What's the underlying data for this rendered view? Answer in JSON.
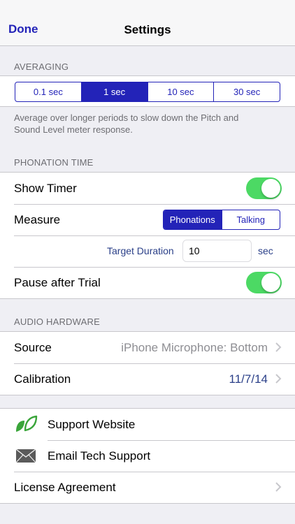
{
  "nav": {
    "done_label": "Done",
    "title": "Settings"
  },
  "averaging": {
    "header": "AVERAGING",
    "options": [
      "0.1 sec",
      "1 sec",
      "10 sec",
      "30 sec"
    ],
    "selected": "1 sec",
    "footer": "Average over longer periods to slow down the Pitch and Sound Level meter response."
  },
  "phonation": {
    "header": "PHONATION TIME",
    "show_timer": {
      "label": "Show Timer",
      "on": true
    },
    "measure": {
      "label": "Measure",
      "options": [
        "Phonations",
        "Talking"
      ],
      "selected": "Phonations"
    },
    "target": {
      "label": "Target Duration",
      "value": "10",
      "unit": "sec"
    },
    "pause": {
      "label": "Pause after Trial",
      "on": true
    }
  },
  "audio": {
    "header": "AUDIO HARDWARE",
    "source": {
      "label": "Source",
      "value": "iPhone Microphone: Bottom"
    },
    "calibration": {
      "label": "Calibration",
      "value": "11/7/14"
    }
  },
  "support": {
    "website": {
      "label": "Support Website",
      "icon": "leaf-icon"
    },
    "email": {
      "label": "Email Tech Support",
      "icon": "envelope-icon"
    },
    "license": {
      "label": "License Agreement"
    }
  },
  "colors": {
    "accent": "#2323b8",
    "toggle_on": "#4cd964",
    "detail_blue": "#2a3f88",
    "leaf_green": "#3aa53a"
  }
}
